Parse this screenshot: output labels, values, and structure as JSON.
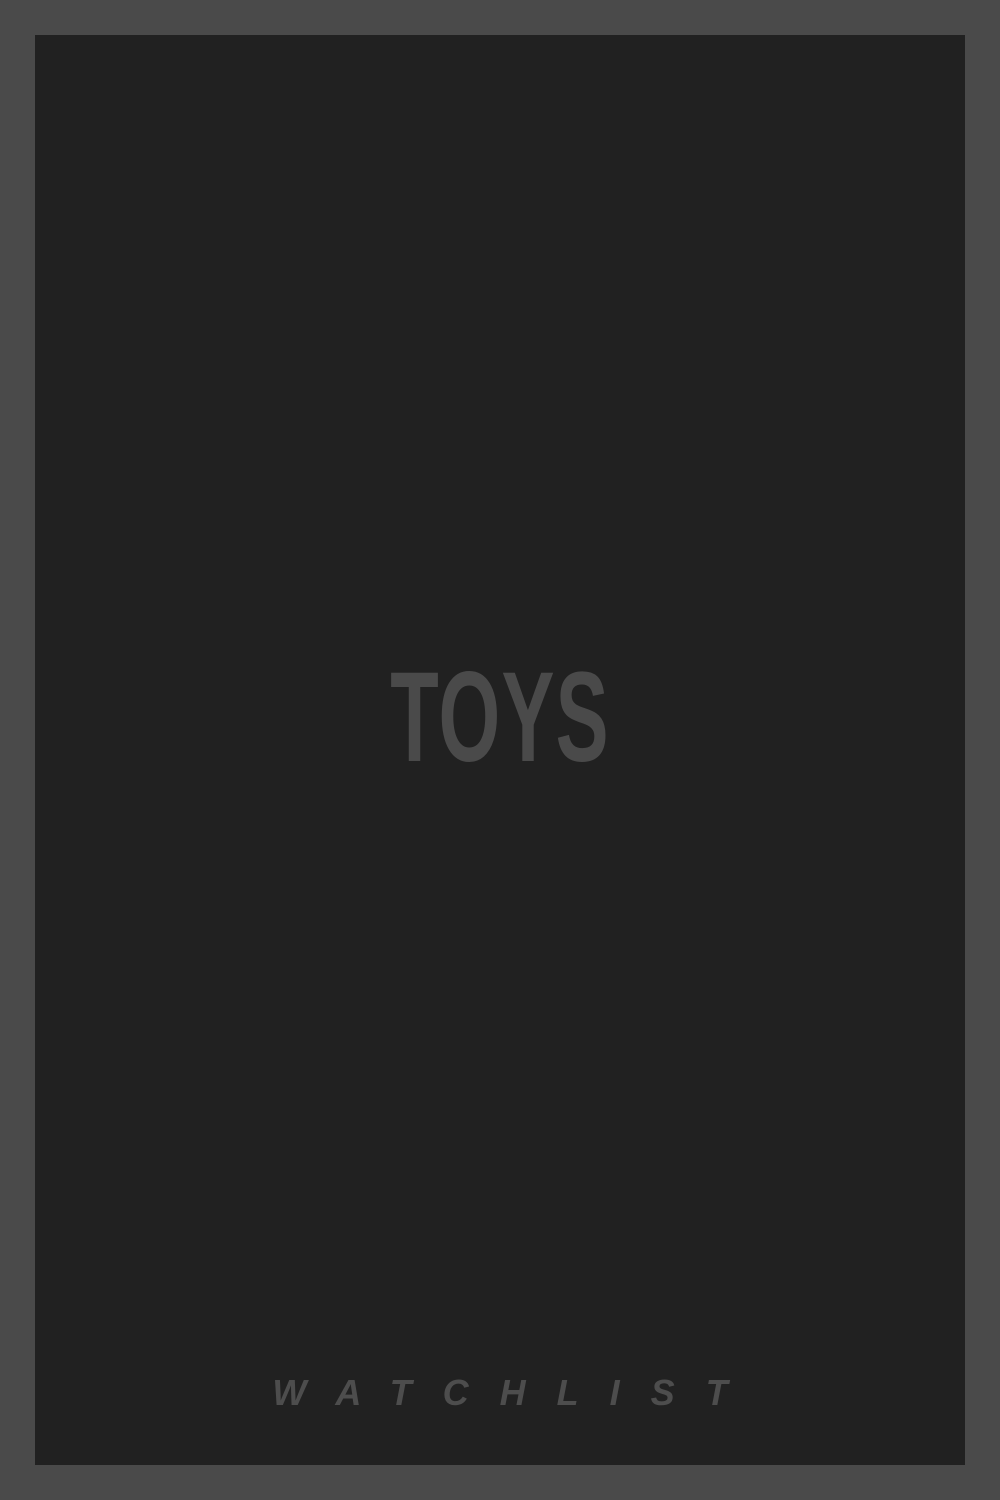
{
  "poster": {
    "title": "TOYS",
    "subtitle": "WATCHLIST"
  },
  "colors": {
    "frame": "#4a4a4a",
    "background": "#212121",
    "title_text": "#4a4a4a",
    "subtitle_text": "#4d4d4d"
  }
}
